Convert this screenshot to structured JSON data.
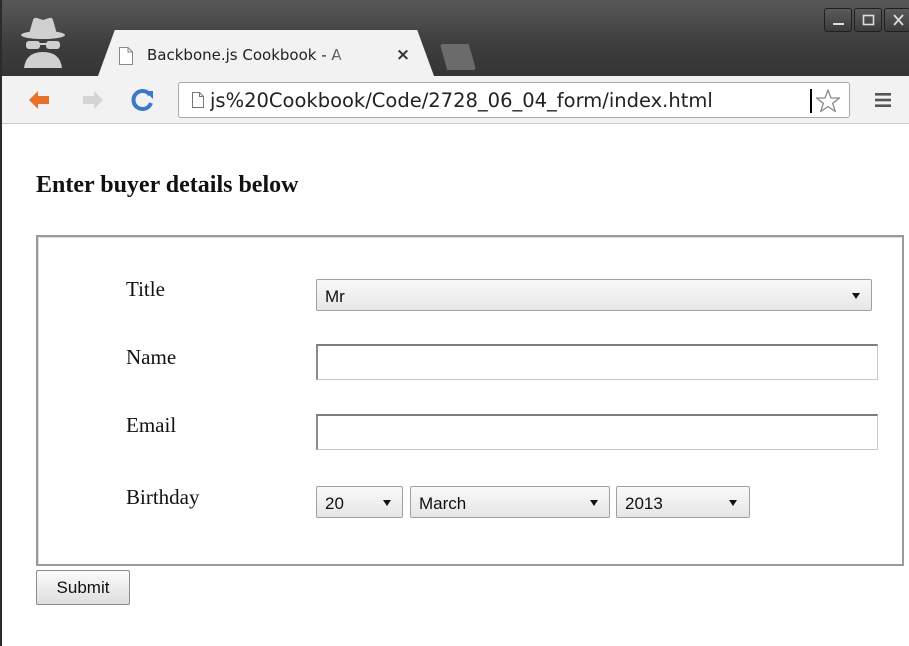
{
  "browser": {
    "tab_title": "Backbone.js Cookbook - A",
    "tab_close": "×",
    "url": "js%20Cookbook/Code/2728_06_04_form/index.html"
  },
  "icons": {
    "profile": "incognito-icon",
    "tab_page": "page-icon",
    "back": "back-arrow-icon",
    "forward": "forward-arrow-icon",
    "reload": "reload-icon",
    "bookmark": "star-icon",
    "menu": "menu-icon"
  },
  "colors": {
    "back_arrow": "#e8722a",
    "reload": "#3b78c8",
    "titlebar": "#3d3d3d"
  },
  "page": {
    "heading": "Enter buyer details below",
    "form": {
      "title_label": "Title",
      "title_value": "Mr",
      "name_label": "Name",
      "name_value": "",
      "email_label": "Email",
      "email_value": "",
      "birthday_label": "Birthday",
      "birthday_day": "20",
      "birthday_month": "March",
      "birthday_year": "2013",
      "submit_label": "Submit"
    }
  }
}
